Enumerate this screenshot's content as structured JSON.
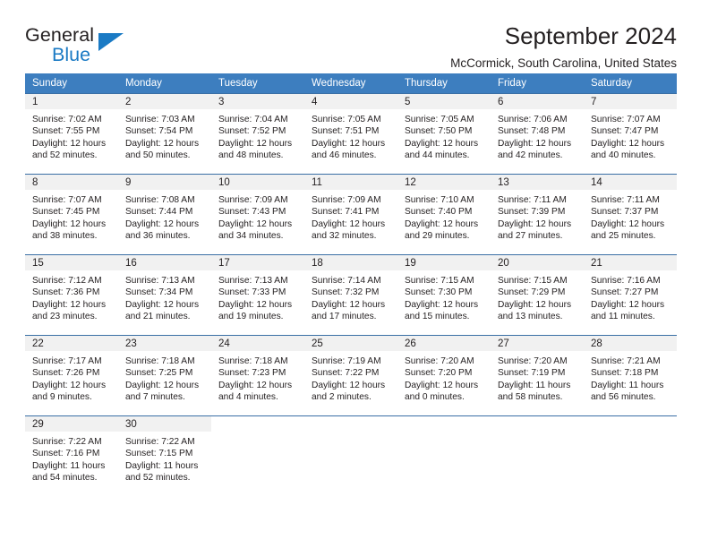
{
  "logo": {
    "word1": "General",
    "word2": "Blue",
    "triangle_color": "#1a7ac4",
    "icon": "general-blue-logo"
  },
  "header": {
    "title": "September 2024",
    "subtitle": "McCormick, South Carolina, United States"
  },
  "calendar": {
    "accent_color": "#3d7ebf",
    "daynum_bg": "#f1f1f1",
    "row_border_color": "#3a6fa5",
    "weekdays": [
      "Sunday",
      "Monday",
      "Tuesday",
      "Wednesday",
      "Thursday",
      "Friday",
      "Saturday"
    ],
    "weeks": [
      [
        {
          "day": "1",
          "sunrise": "Sunrise: 7:02 AM",
          "sunset": "Sunset: 7:55 PM",
          "daylight1": "Daylight: 12 hours",
          "daylight2": "and 52 minutes."
        },
        {
          "day": "2",
          "sunrise": "Sunrise: 7:03 AM",
          "sunset": "Sunset: 7:54 PM",
          "daylight1": "Daylight: 12 hours",
          "daylight2": "and 50 minutes."
        },
        {
          "day": "3",
          "sunrise": "Sunrise: 7:04 AM",
          "sunset": "Sunset: 7:52 PM",
          "daylight1": "Daylight: 12 hours",
          "daylight2": "and 48 minutes."
        },
        {
          "day": "4",
          "sunrise": "Sunrise: 7:05 AM",
          "sunset": "Sunset: 7:51 PM",
          "daylight1": "Daylight: 12 hours",
          "daylight2": "and 46 minutes."
        },
        {
          "day": "5",
          "sunrise": "Sunrise: 7:05 AM",
          "sunset": "Sunset: 7:50 PM",
          "daylight1": "Daylight: 12 hours",
          "daylight2": "and 44 minutes."
        },
        {
          "day": "6",
          "sunrise": "Sunrise: 7:06 AM",
          "sunset": "Sunset: 7:48 PM",
          "daylight1": "Daylight: 12 hours",
          "daylight2": "and 42 minutes."
        },
        {
          "day": "7",
          "sunrise": "Sunrise: 7:07 AM",
          "sunset": "Sunset: 7:47 PM",
          "daylight1": "Daylight: 12 hours",
          "daylight2": "and 40 minutes."
        }
      ],
      [
        {
          "day": "8",
          "sunrise": "Sunrise: 7:07 AM",
          "sunset": "Sunset: 7:45 PM",
          "daylight1": "Daylight: 12 hours",
          "daylight2": "and 38 minutes."
        },
        {
          "day": "9",
          "sunrise": "Sunrise: 7:08 AM",
          "sunset": "Sunset: 7:44 PM",
          "daylight1": "Daylight: 12 hours",
          "daylight2": "and 36 minutes."
        },
        {
          "day": "10",
          "sunrise": "Sunrise: 7:09 AM",
          "sunset": "Sunset: 7:43 PM",
          "daylight1": "Daylight: 12 hours",
          "daylight2": "and 34 minutes."
        },
        {
          "day": "11",
          "sunrise": "Sunrise: 7:09 AM",
          "sunset": "Sunset: 7:41 PM",
          "daylight1": "Daylight: 12 hours",
          "daylight2": "and 32 minutes."
        },
        {
          "day": "12",
          "sunrise": "Sunrise: 7:10 AM",
          "sunset": "Sunset: 7:40 PM",
          "daylight1": "Daylight: 12 hours",
          "daylight2": "and 29 minutes."
        },
        {
          "day": "13",
          "sunrise": "Sunrise: 7:11 AM",
          "sunset": "Sunset: 7:39 PM",
          "daylight1": "Daylight: 12 hours",
          "daylight2": "and 27 minutes."
        },
        {
          "day": "14",
          "sunrise": "Sunrise: 7:11 AM",
          "sunset": "Sunset: 7:37 PM",
          "daylight1": "Daylight: 12 hours",
          "daylight2": "and 25 minutes."
        }
      ],
      [
        {
          "day": "15",
          "sunrise": "Sunrise: 7:12 AM",
          "sunset": "Sunset: 7:36 PM",
          "daylight1": "Daylight: 12 hours",
          "daylight2": "and 23 minutes."
        },
        {
          "day": "16",
          "sunrise": "Sunrise: 7:13 AM",
          "sunset": "Sunset: 7:34 PM",
          "daylight1": "Daylight: 12 hours",
          "daylight2": "and 21 minutes."
        },
        {
          "day": "17",
          "sunrise": "Sunrise: 7:13 AM",
          "sunset": "Sunset: 7:33 PM",
          "daylight1": "Daylight: 12 hours",
          "daylight2": "and 19 minutes."
        },
        {
          "day": "18",
          "sunrise": "Sunrise: 7:14 AM",
          "sunset": "Sunset: 7:32 PM",
          "daylight1": "Daylight: 12 hours",
          "daylight2": "and 17 minutes."
        },
        {
          "day": "19",
          "sunrise": "Sunrise: 7:15 AM",
          "sunset": "Sunset: 7:30 PM",
          "daylight1": "Daylight: 12 hours",
          "daylight2": "and 15 minutes."
        },
        {
          "day": "20",
          "sunrise": "Sunrise: 7:15 AM",
          "sunset": "Sunset: 7:29 PM",
          "daylight1": "Daylight: 12 hours",
          "daylight2": "and 13 minutes."
        },
        {
          "day": "21",
          "sunrise": "Sunrise: 7:16 AM",
          "sunset": "Sunset: 7:27 PM",
          "daylight1": "Daylight: 12 hours",
          "daylight2": "and 11 minutes."
        }
      ],
      [
        {
          "day": "22",
          "sunrise": "Sunrise: 7:17 AM",
          "sunset": "Sunset: 7:26 PM",
          "daylight1": "Daylight: 12 hours",
          "daylight2": "and 9 minutes."
        },
        {
          "day": "23",
          "sunrise": "Sunrise: 7:18 AM",
          "sunset": "Sunset: 7:25 PM",
          "daylight1": "Daylight: 12 hours",
          "daylight2": "and 7 minutes."
        },
        {
          "day": "24",
          "sunrise": "Sunrise: 7:18 AM",
          "sunset": "Sunset: 7:23 PM",
          "daylight1": "Daylight: 12 hours",
          "daylight2": "and 4 minutes."
        },
        {
          "day": "25",
          "sunrise": "Sunrise: 7:19 AM",
          "sunset": "Sunset: 7:22 PM",
          "daylight1": "Daylight: 12 hours",
          "daylight2": "and 2 minutes."
        },
        {
          "day": "26",
          "sunrise": "Sunrise: 7:20 AM",
          "sunset": "Sunset: 7:20 PM",
          "daylight1": "Daylight: 12 hours",
          "daylight2": "and 0 minutes."
        },
        {
          "day": "27",
          "sunrise": "Sunrise: 7:20 AM",
          "sunset": "Sunset: 7:19 PM",
          "daylight1": "Daylight: 11 hours",
          "daylight2": "and 58 minutes."
        },
        {
          "day": "28",
          "sunrise": "Sunrise: 7:21 AM",
          "sunset": "Sunset: 7:18 PM",
          "daylight1": "Daylight: 11 hours",
          "daylight2": "and 56 minutes."
        }
      ],
      [
        {
          "day": "29",
          "sunrise": "Sunrise: 7:22 AM",
          "sunset": "Sunset: 7:16 PM",
          "daylight1": "Daylight: 11 hours",
          "daylight2": "and 54 minutes."
        },
        {
          "day": "30",
          "sunrise": "Sunrise: 7:22 AM",
          "sunset": "Sunset: 7:15 PM",
          "daylight1": "Daylight: 11 hours",
          "daylight2": "and 52 minutes."
        },
        {
          "day": "",
          "sunrise": "",
          "sunset": "",
          "daylight1": "",
          "daylight2": ""
        },
        {
          "day": "",
          "sunrise": "",
          "sunset": "",
          "daylight1": "",
          "daylight2": ""
        },
        {
          "day": "",
          "sunrise": "",
          "sunset": "",
          "daylight1": "",
          "daylight2": ""
        },
        {
          "day": "",
          "sunrise": "",
          "sunset": "",
          "daylight1": "",
          "daylight2": ""
        },
        {
          "day": "",
          "sunrise": "",
          "sunset": "",
          "daylight1": "",
          "daylight2": ""
        }
      ]
    ]
  }
}
